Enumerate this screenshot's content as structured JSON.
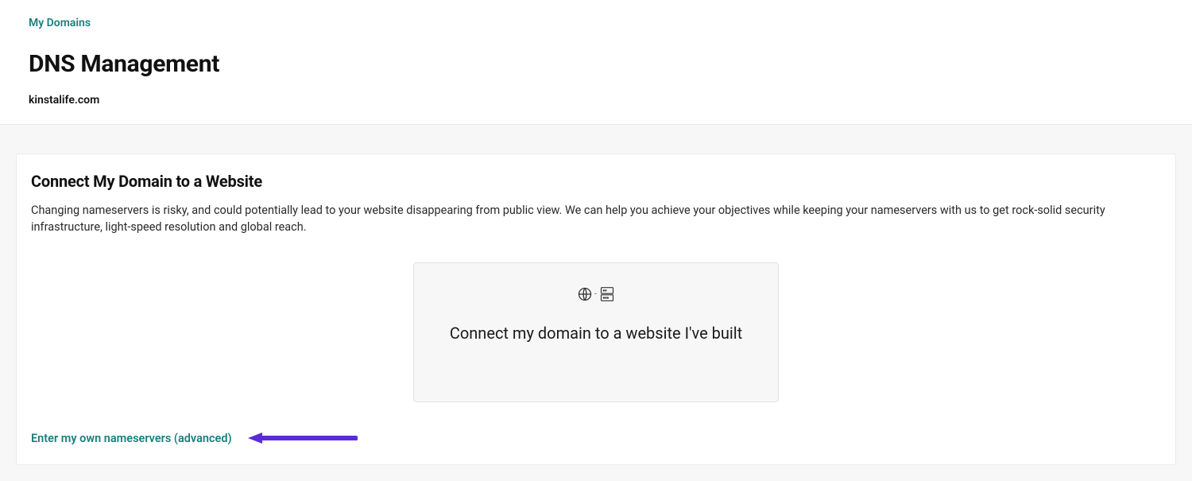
{
  "breadcrumb": {
    "label": "My Domains"
  },
  "page_title": "DNS Management",
  "domain_name": "kinstalife.com",
  "connect_card": {
    "title": "Connect My Domain to a Website",
    "description": "Changing nameservers is risky, and could potentially lead to your website disappearing from public view. We can help you achieve your objectives while keeping your nameservers with us to get rock-solid security infrastructure, light-speed resolution and global reach.",
    "option_label": "Connect my domain to a website I've built",
    "advanced_link": "Enter my own nameservers (advanced)"
  }
}
